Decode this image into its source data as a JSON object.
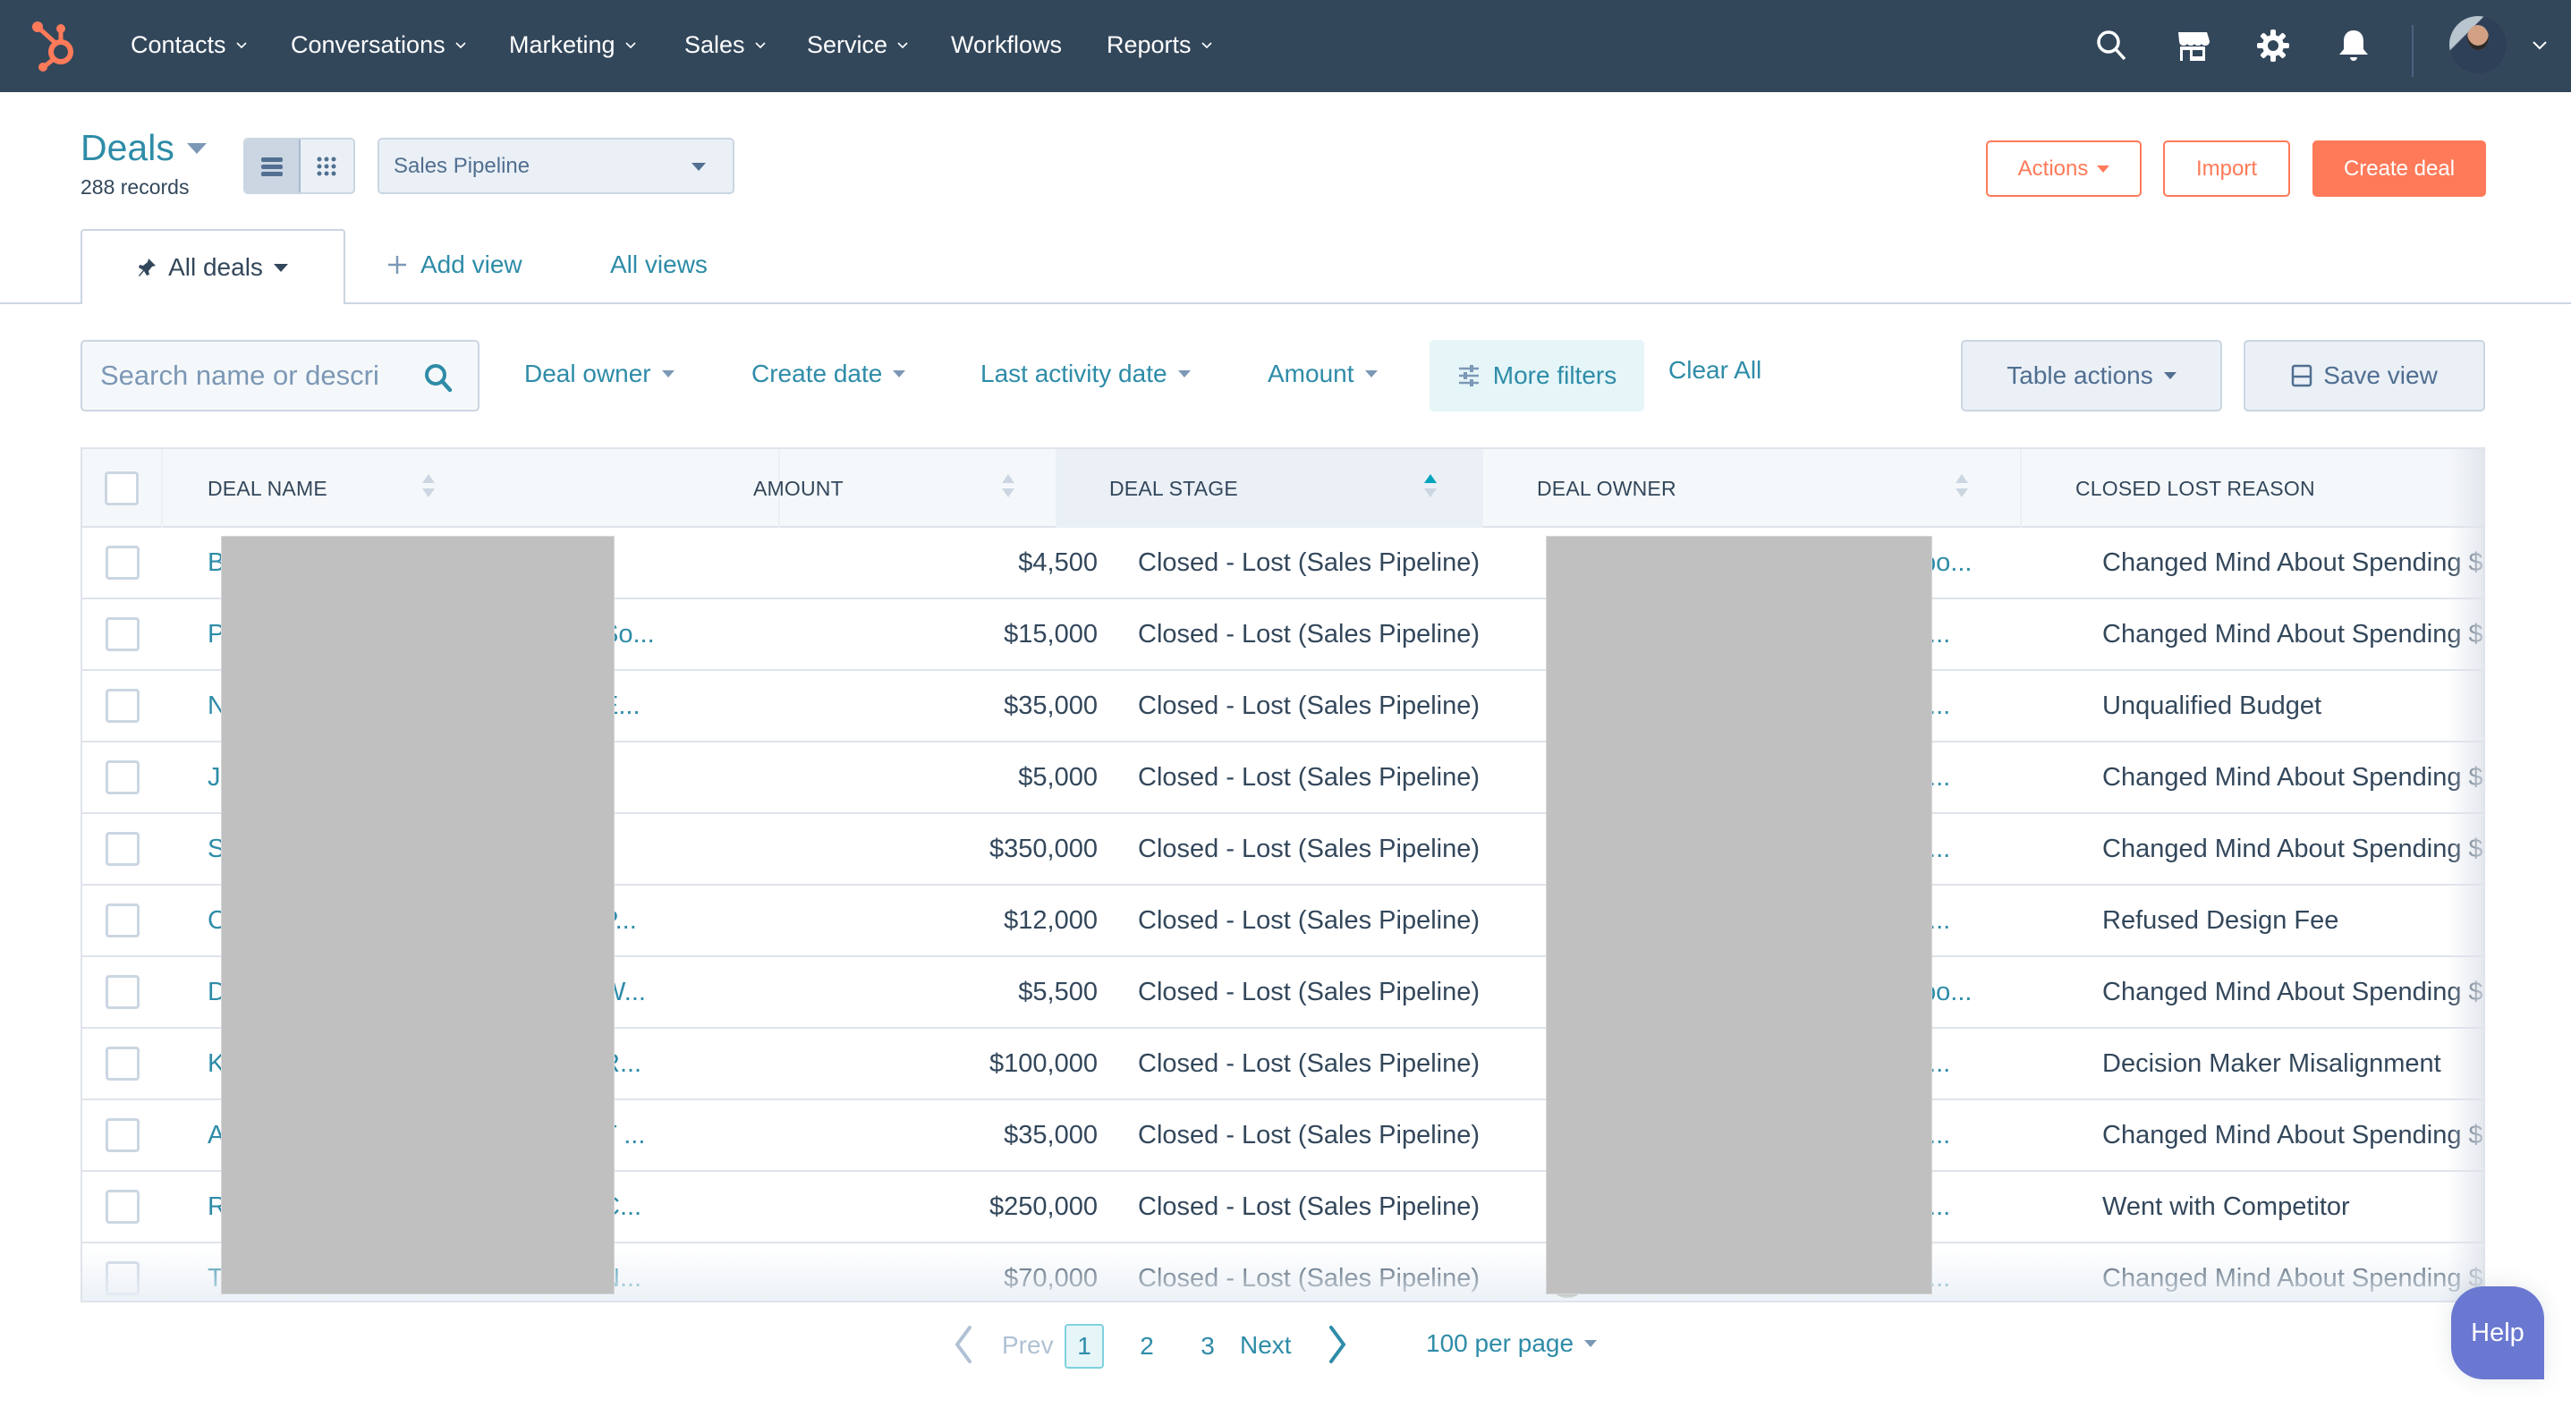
{
  "nav": {
    "logo": "hubspot-sprocket-logo",
    "items": [
      {
        "label": "Contacts",
        "has_dropdown": true
      },
      {
        "label": "Conversations",
        "has_dropdown": true
      },
      {
        "label": "Marketing",
        "has_dropdown": true
      },
      {
        "label": "Sales",
        "has_dropdown": true
      },
      {
        "label": "Service",
        "has_dropdown": true
      },
      {
        "label": "Workflows",
        "has_dropdown": false
      },
      {
        "label": "Reports",
        "has_dropdown": true
      }
    ],
    "icons": [
      "search-icon",
      "marketplace-icon",
      "settings-icon",
      "notifications-icon"
    ],
    "account": "user-avatar"
  },
  "header": {
    "title": "Deals",
    "record_count": "288 records",
    "view_modes": [
      "list-view",
      "board-view"
    ],
    "active_view_mode": "list-view",
    "pipeline": "Sales Pipeline",
    "actions_label": "Actions",
    "import_label": "Import",
    "create_label": "Create deal"
  },
  "tabs": {
    "active": "All deals",
    "add_view": "Add view",
    "all_views": "All views"
  },
  "filters": {
    "search_placeholder": "Search name or descri",
    "search_value": "",
    "dropdowns": [
      "Deal owner",
      "Create date",
      "Last activity date",
      "Amount"
    ],
    "more_filters": "More filters",
    "clear_all": "Clear All",
    "table_actions": "Table actions",
    "save_view": "Save view"
  },
  "table": {
    "columns": [
      {
        "label": "DEAL NAME",
        "sortable": true,
        "sort": "none"
      },
      {
        "label": "AMOUNT",
        "sortable": true,
        "sort": "none"
      },
      {
        "label": "DEAL STAGE",
        "sortable": true,
        "sort": "ascending"
      },
      {
        "label": "DEAL OWNER",
        "sortable": true,
        "sort": "none"
      },
      {
        "label": "CLOSED LOST REASON",
        "sortable": false,
        "sort": "none"
      }
    ],
    "rows": [
      {
        "name_start": "B",
        "name_end": "",
        "amount": "$4,500",
        "stage": "Closed - Lost (Sales Pipeline)",
        "owner_end": "bo...",
        "reason": "Changed Mind About Spending $"
      },
      {
        "name_start": "P",
        "name_end": "So...",
        "amount": "$15,000",
        "stage": "Closed - Lost (Sales Pipeline)",
        "owner_end": "f...",
        "reason": "Changed Mind About Spending $"
      },
      {
        "name_start": "N",
        "name_end": "E...",
        "amount": "$35,000",
        "stage": "Closed - Lost (Sales Pipeline)",
        "owner_end": "f...",
        "reason": "Unqualified Budget"
      },
      {
        "name_start": "J",
        "name_end": "",
        "amount": "$5,000",
        "stage": "Closed - Lost (Sales Pipeline)",
        "owner_end": "f...",
        "reason": "Changed Mind About Spending $"
      },
      {
        "name_start": "S",
        "name_end": "",
        "amount": "$350,000",
        "stage": "Closed - Lost (Sales Pipeline)",
        "owner_end": "f...",
        "reason": "Changed Mind About Spending $"
      },
      {
        "name_start": "C",
        "name_end": "P...",
        "amount": "$12,000",
        "stage": "Closed - Lost (Sales Pipeline)",
        "owner_end": "f...",
        "reason": "Refused Design Fee"
      },
      {
        "name_start": "D",
        "name_end": "W...",
        "amount": "$5,500",
        "stage": "Closed - Lost (Sales Pipeline)",
        "owner_end": "bo...",
        "reason": "Changed Mind About Spending $"
      },
      {
        "name_start": "K",
        "name_end": "R...",
        "amount": "$100,000",
        "stage": "Closed - Lost (Sales Pipeline)",
        "owner_end": "f...",
        "reason": "Decision Maker Misalignment"
      },
      {
        "name_start": "A",
        "name_end": "T ...",
        "amount": "$35,000",
        "stage": "Closed - Lost (Sales Pipeline)",
        "owner_end": "f...",
        "reason": "Changed Mind About Spending $"
      },
      {
        "name_start": "R",
        "name_end": "C...",
        "amount": "$250,000",
        "stage": "Closed - Lost (Sales Pipeline)",
        "owner_end": "f...",
        "reason": "Went with Competitor"
      },
      {
        "name_start": "T",
        "name_end": "N...",
        "amount": "$70,000",
        "stage": "Closed - Lost (Sales Pipeline)",
        "owner_end": "f...",
        "reason": "Changed Mind About Spending $"
      }
    ]
  },
  "pagination": {
    "prev_label": "Prev",
    "pages": [
      "1",
      "2",
      "3"
    ],
    "current_page": "1",
    "next_label": "Next",
    "per_page": "100 per page"
  },
  "help_label": "Help",
  "colors": {
    "nav_bg": "#33475b",
    "brand_orange": "#ff7a59",
    "link_teal": "#2e8ca8",
    "help_purple": "#6a78d1",
    "text_dark": "#33475b",
    "redaction_gray": "#c0c0c0"
  }
}
